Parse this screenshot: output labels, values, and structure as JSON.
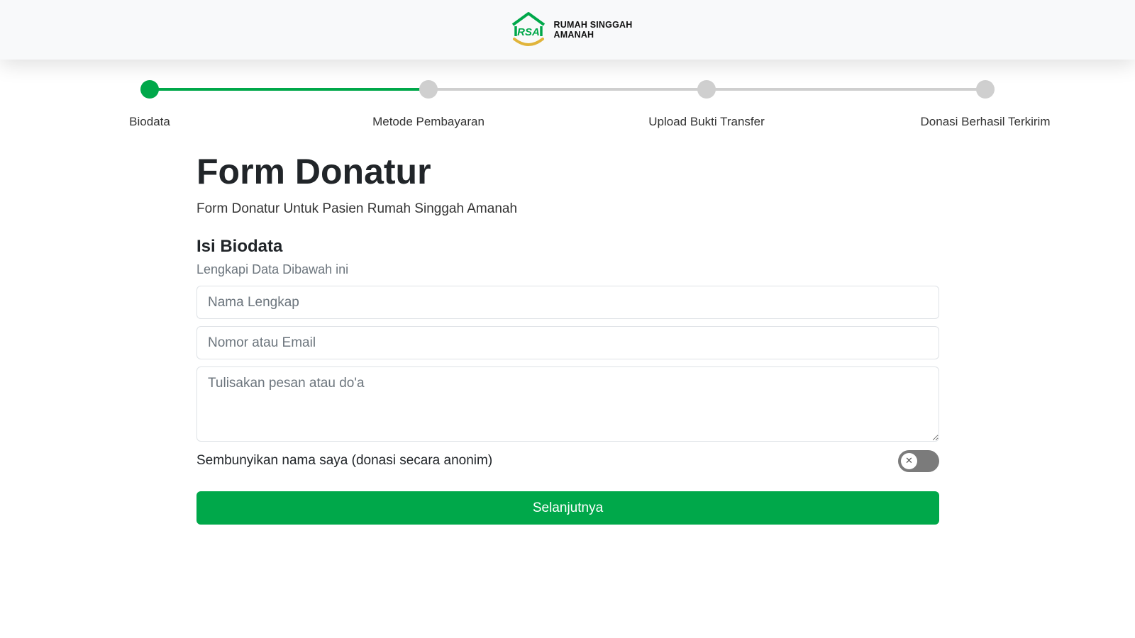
{
  "header": {
    "brand_line1": "RUMAH SINGGAH",
    "brand_line2": "AMANAH",
    "logo_icon": "rsa-house-logo-icon",
    "brand_color": "#00a84a",
    "accent_color": "#e0b43a"
  },
  "stepper": {
    "steps": [
      {
        "label": "Biodata",
        "status": "active"
      },
      {
        "label": "Metode Pembayaran",
        "status": "pending"
      },
      {
        "label": "Upload Bukti Transfer",
        "status": "pending"
      },
      {
        "label": "Donasi Berhasil Terkirim",
        "status": "pending"
      }
    ],
    "progress_fraction": 0.333,
    "active_color": "#00a84a",
    "inactive_color": "#cfcfcf"
  },
  "form": {
    "title": "Form Donatur",
    "subtitle": "Form Donatur Untuk Pasien Rumah Singgah Amanah",
    "section_title": "Isi Biodata",
    "section_subtitle": "Lengkapi Data Dibawah ini",
    "name_placeholder": "Nama Lengkap",
    "name_value": "",
    "contact_placeholder": "Nomor atau Email",
    "contact_value": "",
    "message_placeholder": "Tulisakan pesan atau do'a",
    "message_value": "",
    "anonymous_label": "Sembunyikan nama saya (donasi secara anonim)",
    "anonymous_enabled": false,
    "toggle_icon": "x-icon",
    "submit_label": "Selanjutnya"
  }
}
